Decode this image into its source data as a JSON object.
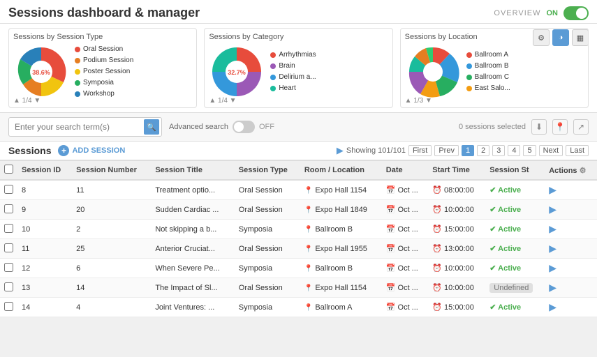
{
  "header": {
    "title": "Sessions dashboard & manager",
    "overview_label": "OVERVIEW",
    "toggle_state": "ON"
  },
  "charts_toolbar": {
    "gear": "⚙",
    "pie": "◑",
    "grid": "▦"
  },
  "charts": [
    {
      "title": "Sessions by Session Type",
      "nav": "1/4",
      "segments": [
        {
          "label": "Oral Session",
          "color": "#e74c3c",
          "value": 38.6
        },
        {
          "label": "Podium Session",
          "color": "#e67e22",
          "value": 17.8
        },
        {
          "label": "Poster Session",
          "color": "#f1c40f",
          "value": 23.8
        },
        {
          "label": "Symposia",
          "color": "#27ae60",
          "value": 12
        },
        {
          "label": "Workshop",
          "color": "#2980b9",
          "value": 7.8
        }
      ]
    },
    {
      "title": "Sessions by Category",
      "nav": "1/4",
      "segments": [
        {
          "label": "Arrhythmias",
          "color": "#e74c3c",
          "value": 32.7
        },
        {
          "label": "Brain",
          "color": "#9b59b6",
          "value": 21.8
        },
        {
          "label": "Delirium a...",
          "color": "#3498db",
          "value": 18
        },
        {
          "label": "Heart",
          "color": "#1abc9c",
          "value": 27.5
        }
      ]
    },
    {
      "title": "Sessions by Location",
      "nav": "1/3",
      "segments": [
        {
          "label": "Ballroom A",
          "color": "#e74c3c",
          "value": 20
        },
        {
          "label": "Ballroom B",
          "color": "#3498db",
          "value": 18
        },
        {
          "label": "Ballroom C",
          "color": "#27ae60",
          "value": 15
        },
        {
          "label": "East Salo...",
          "color": "#f39c12",
          "value": 12
        },
        {
          "label": "",
          "color": "#9b59b6",
          "value": 10
        },
        {
          "label": "",
          "color": "#1abc9c",
          "value": 10
        },
        {
          "label": "",
          "color": "#e67e22",
          "value": 8
        },
        {
          "label": "",
          "color": "#2ecc71",
          "value": 7
        }
      ]
    }
  ],
  "search": {
    "placeholder": "Enter your search term(s)",
    "advanced_label": "Advanced search",
    "toggle_state": "OFF",
    "selected_label": "0 sessions selected"
  },
  "sessions": {
    "title": "Sessions",
    "add_label": "ADD SESSION",
    "showing_label": "Showing 101/101",
    "pagination": {
      "first": "First",
      "prev": "Prev",
      "pages": [
        "1",
        "2",
        "3",
        "4",
        "5"
      ],
      "next": "Next",
      "last": "Last"
    },
    "columns": [
      "Session ID",
      "Session Number",
      "Session Title",
      "Session Type",
      "Room / Location",
      "Date",
      "Start Time",
      "Session St",
      "Actions"
    ],
    "rows": [
      {
        "id": "8",
        "number": "11",
        "title": "Treatment optio...",
        "type": "Oral Session",
        "location": "Expo Hall 1154",
        "date": "Oct ...",
        "start": "08:00:00",
        "status": "Active",
        "status_type": "active"
      },
      {
        "id": "9",
        "number": "20",
        "title": "Sudden Cardiac ...",
        "type": "Oral Session",
        "location": "Expo Hall 1849",
        "date": "Oct ...",
        "start": "10:00:00",
        "status": "Active",
        "status_type": "active"
      },
      {
        "id": "10",
        "number": "2",
        "title": "Not skipping a b...",
        "type": "Symposia",
        "location": "Ballroom B",
        "date": "Oct ...",
        "start": "15:00:00",
        "status": "Active",
        "status_type": "active"
      },
      {
        "id": "11",
        "number": "25",
        "title": "Anterior Cruciat...",
        "type": "Oral Session",
        "location": "Expo Hall 1955",
        "date": "Oct ...",
        "start": "13:00:00",
        "status": "Active",
        "status_type": "active"
      },
      {
        "id": "12",
        "number": "6",
        "title": "When Severe Pe...",
        "type": "Symposia",
        "location": "Ballroom B",
        "date": "Oct ...",
        "start": "10:00:00",
        "status": "Active",
        "status_type": "active"
      },
      {
        "id": "13",
        "number": "14",
        "title": "The Impact of Sl...",
        "type": "Oral Session",
        "location": "Expo Hall 1154",
        "date": "Oct ...",
        "start": "10:00:00",
        "status": "Undefined",
        "status_type": "undefined"
      },
      {
        "id": "14",
        "number": "4",
        "title": "Joint Ventures: ...",
        "type": "Symposia",
        "location": "Ballroom A",
        "date": "Oct ...",
        "start": "15:00:00",
        "status": "Active",
        "status_type": "active"
      }
    ]
  }
}
